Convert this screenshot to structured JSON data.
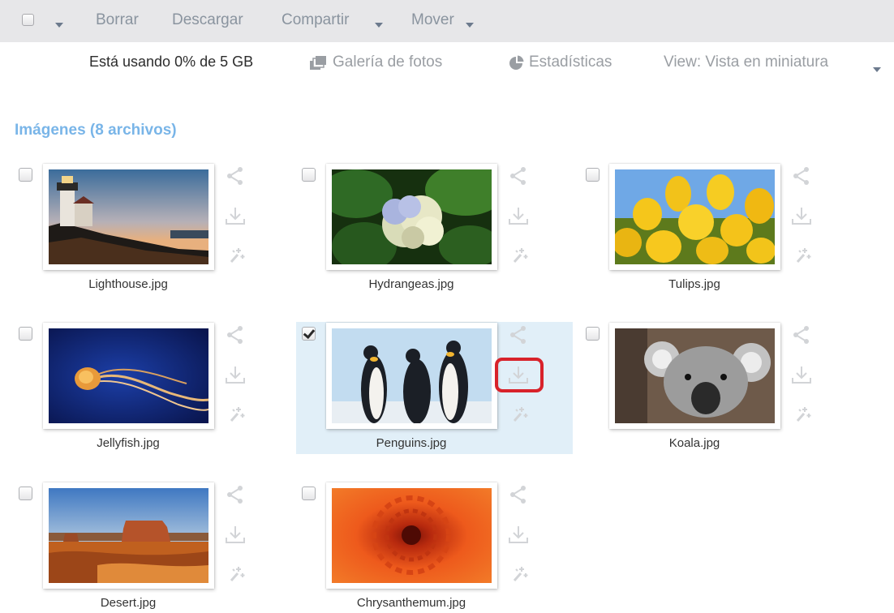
{
  "toolbar": {
    "borrar": "Borrar",
    "descargar": "Descargar",
    "compartir": "Compartir",
    "mover": "Mover"
  },
  "info": {
    "usage": "Está usando 0% de 5 GB",
    "gallery": "Galería de fotos",
    "stats": "Estadísticas",
    "view": "View: Vista en miniatura"
  },
  "section": {
    "title": "Imágenes (8 archivos)"
  },
  "files": [
    {
      "name": "Lighthouse.jpg",
      "selected": false
    },
    {
      "name": "Hydrangeas.jpg",
      "selected": false
    },
    {
      "name": "Tulips.jpg",
      "selected": false
    },
    {
      "name": "Jellyfish.jpg",
      "selected": false
    },
    {
      "name": "Penguins.jpg",
      "selected": true
    },
    {
      "name": "Koala.jpg",
      "selected": false
    },
    {
      "name": "Desert.jpg",
      "selected": false
    },
    {
      "name": "Chrysanthemum.jpg",
      "selected": false
    }
  ],
  "icons": {
    "share": "share-icon",
    "download": "download-icon",
    "effects": "sparkle-icon",
    "gallery": "gallery-icon",
    "stats": "pie-chart-icon"
  },
  "colors": {
    "toolbar_bg": "#e7e7e9",
    "section_title": "#79b5e8",
    "selection_bg": "#e1eff8",
    "highlight": "#d8222a"
  }
}
